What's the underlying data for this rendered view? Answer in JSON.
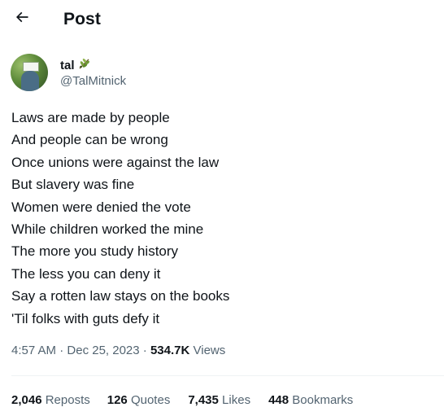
{
  "header": {
    "title": "Post"
  },
  "author": {
    "display_name": "tal",
    "handle": "@TalMitnick",
    "badge_icon": "olive-branch-icon"
  },
  "tweet": {
    "lines": [
      "Laws are made by people",
      "And people can be wrong",
      "Once unions were against the law",
      "But slavery was fine",
      "Women were denied the vote",
      "While children worked the mine",
      "The more you study history",
      "The less you can deny it",
      "Say a rotten law stays on the books",
      "'Til folks with guts defy it"
    ]
  },
  "meta": {
    "time": "4:57 AM",
    "date": "Dec 25, 2023",
    "views_count": "534.7K",
    "views_label": "Views"
  },
  "stats": {
    "reposts": {
      "count": "2,046",
      "label": "Reposts"
    },
    "quotes": {
      "count": "126",
      "label": "Quotes"
    },
    "likes": {
      "count": "7,435",
      "label": "Likes"
    },
    "bookmarks": {
      "count": "448",
      "label": "Bookmarks"
    }
  }
}
